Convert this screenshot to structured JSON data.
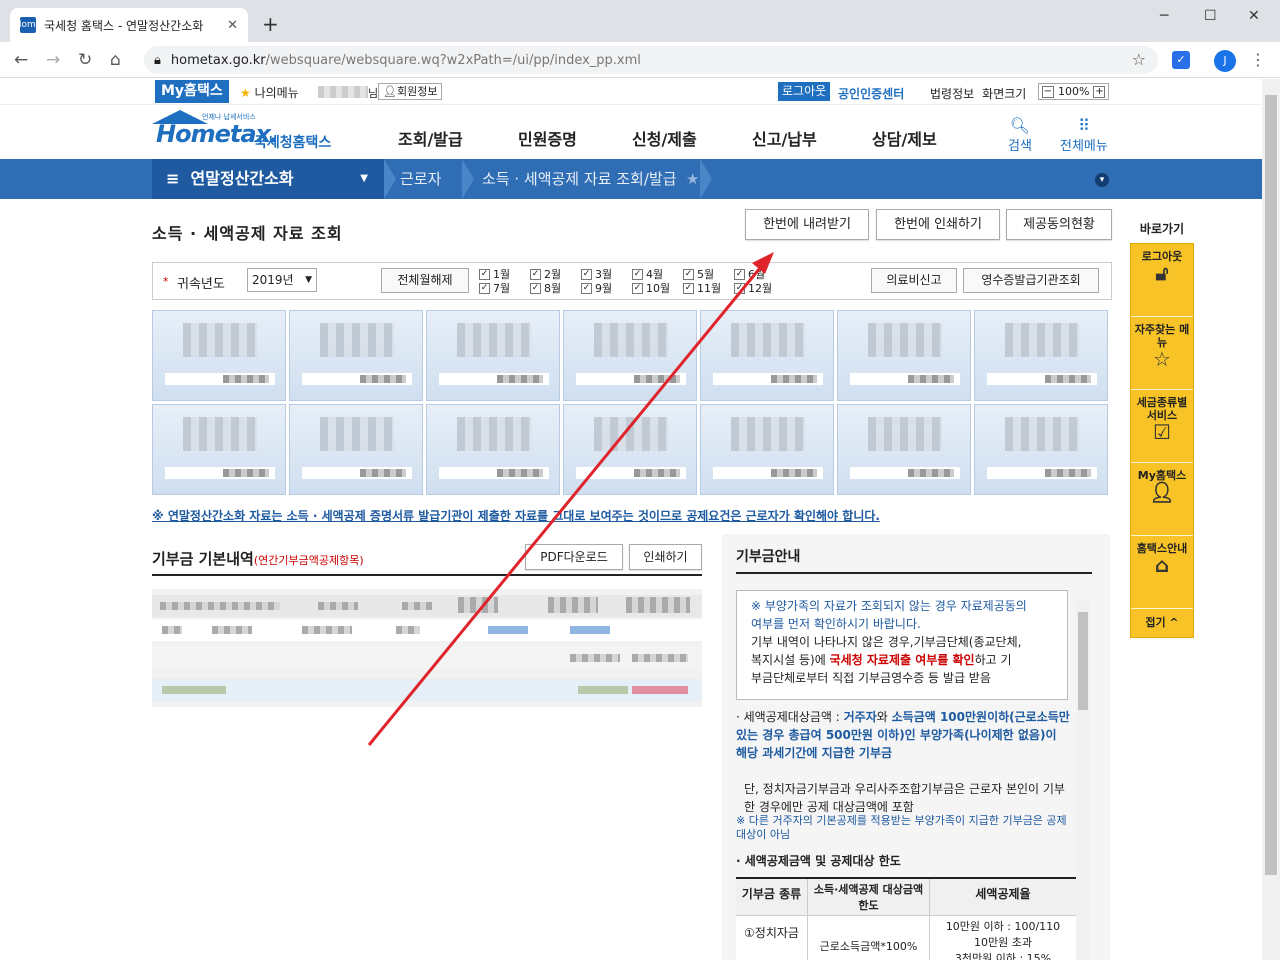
{
  "browser": {
    "tab_title": "국세청 홈택스 - 연말정산간소화",
    "tab_close": "✕",
    "new_tab": "+",
    "favicon": "Home",
    "url_host": "hometax.go.kr",
    "url_path": "/websquare/websquare.wq?w2xPath=/ui/pp/index_pp.xml",
    "profile_initial": "J",
    "win_min": "─",
    "win_max": "☐",
    "win_close": "✕"
  },
  "topbar": {
    "my_hometax": "My홈택스",
    "my_menu": "나의메뉴",
    "name_suffix": "님",
    "member_info": "회원정보",
    "logout": "로그아웃",
    "cert_center": "공인인증센터",
    "legal_info": "법령정보",
    "screen_size": "화면크기",
    "zoom": "100%",
    "zoom_minus": "−",
    "zoom_plus": "+"
  },
  "header": {
    "logo_text": "Hometax.",
    "logo_tagline": "언제나 납세서비스",
    "logo_korean": "국세청홈택스",
    "nav": [
      "조회/발급",
      "민원증명",
      "신청/제출",
      "신고/납부",
      "상담/제보"
    ],
    "search": "검색",
    "all_menu": "전체메뉴"
  },
  "lnb": {
    "main": "연말정산간소화",
    "items": [
      "근로자",
      "소득 · 세액공제 자료 조회/발급"
    ]
  },
  "page": {
    "title": "소득 · 세액공제 자료 조회",
    "btn_download_all": "한번에 내려받기",
    "btn_print_all": "한번에 인쇄하기",
    "btn_consent": "제공동의현황",
    "year_label": "귀속년도",
    "year_value": "2019년",
    "btn_uncheck_all": "전체월해제",
    "months": [
      "1월",
      "2월",
      "3월",
      "4월",
      "5월",
      "6월",
      "7월",
      "8월",
      "9월",
      "10월",
      "11월",
      "12월"
    ],
    "btn_medical_report": "의료비신고",
    "btn_receipt_lookup": "영수증발급기관조회",
    "notice": "※ 연말정산간소화 자료는 소득 · 세액공제 증명서류 발급기관이 제출한 자료를 그대로 보여주는 것이므로 공제요건은 근로자가 확인해야 합니다."
  },
  "donation": {
    "title": "기부금 기본내역",
    "subtitle": "(연간기부금액공제항목)",
    "btn_pdf": "PDF다운로드",
    "btn_print": "인쇄하기"
  },
  "info": {
    "title": "기부금안내",
    "box_line1": "※ 부양가족의 자료가 조회되지 않는 경우 자료제공동의",
    "box_line2": "여부를 먼저 확인하시기 바랍니다.",
    "box_line3": "기부 내역이 나타나지 않은 경우,기부금단체(종교단체,",
    "box_line4a": "복지시설 등)에 ",
    "box_line4b": "국세청 자료제출 여부를 확인",
    "box_line4c": "하고 기",
    "box_line5": "부금단체로부터 직접 기부금영수증 등 발급 받음",
    "p1_a": "· 세액공제대상금액 : ",
    "p1_b": "거주자",
    "p1_c": "와 ",
    "p1_d": "소득금액 100만원이하(근로소득만 있는 경우 총급여 500만원 이하)인 부양가족(나이제한 없음)이 해당 과세기간에 지급한 기부금",
    "p2": "단, 정치자금기부금과 우리사주조합기부금은 근로자 본인이 기부한 경우에만 공제 대상금액에 포함",
    "p3": "※ 다른 거주자의 기본공제를 적용받는 부양가족이 지급한 기부금은 공제대상이 아님",
    "subhead": "· 세액공제금액 및 공제대상 한도",
    "th1": "기부금 종류",
    "th2": "소득·세액공제 대상금액 한도",
    "th3": "세액공제율",
    "td1": "①정치자금",
    "td2": "근로소득금액*100%",
    "td3a": "10만원 이하 : 100/110",
    "td3b": "10만원 초과",
    "td3c": "3천만원 이하 : 15%"
  },
  "quick": {
    "title": "바로가기",
    "items": [
      "로그아웃",
      "자주찾는 메뉴",
      "세금종류별 서비스",
      "My홈택스",
      "홈택스안내"
    ],
    "fold": "접기"
  },
  "colors": {
    "brand_blue": "#1e6fc0",
    "lnb_blue": "#2f6eb5",
    "quick_yellow": "#f7c327",
    "annotation_red": "#e0242c"
  }
}
